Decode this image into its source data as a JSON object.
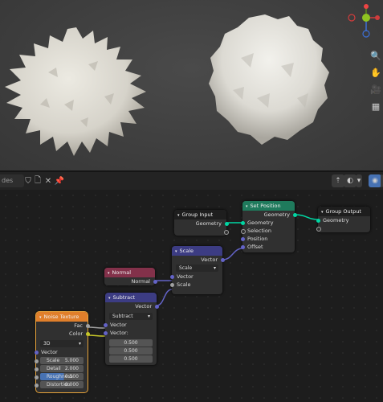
{
  "viewport": {
    "gizmo_axes": [
      "X",
      "Y",
      "Z"
    ]
  },
  "editor_header": {
    "search_text": "des",
    "icons": [
      "shield-icon",
      "file-icon",
      "close-icon",
      "pin-icon",
      "upload-icon",
      "image-icon",
      "overlay-icon",
      "snap-icon"
    ]
  },
  "nodes": {
    "group_input": {
      "title": "Group Input",
      "outputs": [
        "Geometry"
      ]
    },
    "set_position": {
      "title": "Set Position",
      "output": "Geometry",
      "inputs": [
        "Geometry",
        "Selection",
        "Position",
        "Offset"
      ]
    },
    "group_output": {
      "title": "Group Output",
      "inputs": [
        "Geometry"
      ]
    },
    "scale": {
      "title": "Scale",
      "output": "Vector",
      "mode": "Scale",
      "inputs": [
        "Vector",
        "Scale"
      ]
    },
    "normal": {
      "title": "Normal",
      "output": "Normal"
    },
    "subtract": {
      "title": "Subtract",
      "output": "Vector",
      "mode": "Subtract",
      "inputs": [
        "Vector",
        "Vector:"
      ],
      "values": [
        "0.500",
        "0.500",
        "0.500"
      ]
    },
    "noise": {
      "title": "Noise Texture",
      "outputs": [
        "Fac",
        "Color"
      ],
      "dimension": "3D",
      "vector_label": "Vector",
      "fields": [
        {
          "label": "Scale",
          "value": "5.000"
        },
        {
          "label": "Detail",
          "value": "2.000"
        },
        {
          "label": "Roughness",
          "value": "0.500"
        },
        {
          "label": "Distortion",
          "value": "0.000"
        }
      ]
    }
  },
  "colors": {
    "geometry_socket": "#00d6a3",
    "vector_socket": "#6363c7",
    "float_socket": "#a1a1a1",
    "color_socket": "#c7c729",
    "geometry_header": "#1f7a5c",
    "vector_header": "#3c3c83",
    "input_header": "#83314a",
    "texture_header": "#e07f2b",
    "group_header": "#1e1e1e"
  }
}
